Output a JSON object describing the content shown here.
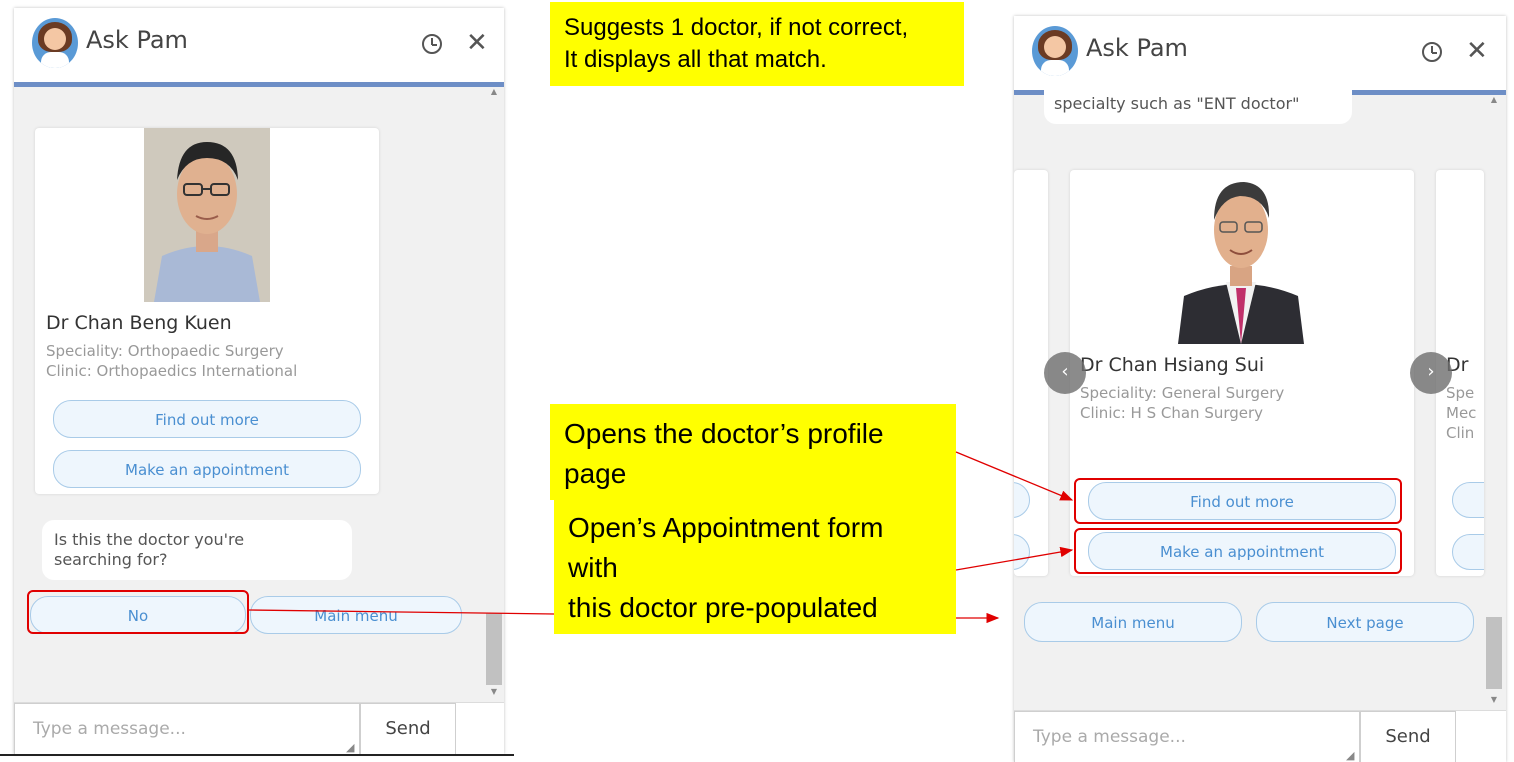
{
  "left_chat": {
    "title": "Ask Pam",
    "doctor": {
      "name": "Dr Chan Beng Kuen",
      "speciality": "Speciality: Orthopaedic Surgery",
      "clinic": "Clinic: Orthopaedics International",
      "find_out_more": "Find out more",
      "make_appointment": "Make an appointment"
    },
    "question_line1": "Is this the doctor you're",
    "question_line2": "searching for?",
    "no_button": "No",
    "main_menu_button": "Main menu",
    "input_placeholder": "Type a message...",
    "send_label": "Send"
  },
  "right_chat": {
    "title": "Ask Pam",
    "top_bubble": "specialty such as \"ENT doctor\"",
    "doctor": {
      "name": "Dr Chan Hsiang Sui",
      "speciality": "Speciality: General Surgery",
      "clinic": "Clinic: H S Chan Surgery",
      "find_out_more": "Find out more",
      "make_appointment": "Make an appointment"
    },
    "next_card": {
      "name_partial": "Dr",
      "line1_partial": "Spe",
      "line2_partial": "Mec",
      "line3_partial": "Clin"
    },
    "main_menu_button": "Main menu",
    "next_page_button": "Next page",
    "input_placeholder": "Type a message...",
    "send_label": "Send"
  },
  "annotations": {
    "top_line1": "Suggests 1 doctor, if not correct,",
    "top_line2": "It displays all that match.",
    "profile_line1": "Opens the doctor’s profile",
    "profile_line2": "page",
    "appointment_line1": "Open’s Appointment form",
    "appointment_line2": "with",
    "appointment_line3": "this doctor pre-populated"
  },
  "icons": [
    "avatar-icon",
    "clock-icon",
    "close-icon",
    "chevron-left-icon",
    "chevron-right-icon",
    "resize-grip-icon"
  ],
  "colors": {
    "header_underline": "#6d8ec6",
    "pill_border": "#a9cbe8",
    "pill_text": "#4a8fd1",
    "annotation_bg": "#ffff00",
    "highlight_red": "#e00000"
  }
}
